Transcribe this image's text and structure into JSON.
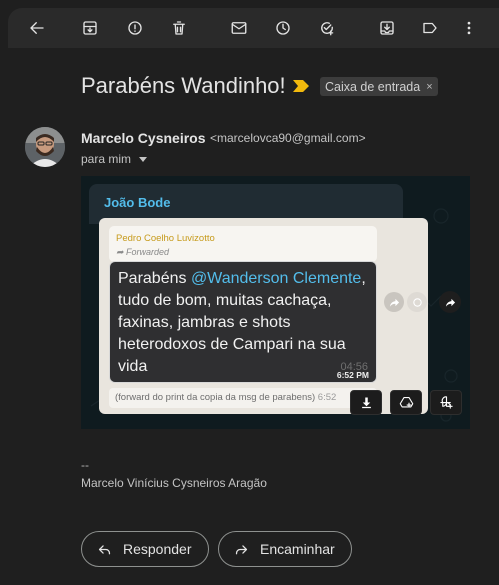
{
  "toolbar": {
    "icons": [
      "back-arrow-icon",
      "archive-icon",
      "report-spam-icon",
      "delete-icon",
      "mark-unread-icon",
      "snooze-icon",
      "add-to-tasks-icon",
      "move-to-icon",
      "label-icon",
      "more-vert-icon"
    ]
  },
  "email": {
    "subject": "Parabéns Wandinho!",
    "label": "Caixa de entrada",
    "label_remove": "×",
    "sender_name": "Marcelo Cysneiros",
    "sender_email": "<marcelovca90@gmail.com>",
    "to_text": "para mim"
  },
  "attachment": {
    "chat_name": "João Bode",
    "quote_author": "Pedro Coelho Luvizotto",
    "quote_forwarded": "Forwarded",
    "message_prefix": "Parabéns ",
    "message_mention": "@Wanderson Clemente",
    "message_rest": ", tudo de bom, muitas cachaça, faxinas, jambras e shots heterodoxos de Campari na sua vida",
    "time_ghost": "04:56",
    "time": "6:52 PM",
    "caption": "(forward do print da copia da msg de parabens)",
    "caption_time": "6:52"
  },
  "signature": {
    "dash": "--",
    "name": "Marcelo Vinícius Cysneiros Aragão"
  },
  "actions": {
    "reply_label": "Responder",
    "forward_label": "Encaminhar"
  },
  "colors": {
    "background": "#1f1f1f",
    "toolbar": "#2a2a2a",
    "importance_marker": "#f2b90d",
    "mention": "#53bdeb",
    "chat_title": "#53bdeb",
    "quote_author": "#c79b1c"
  }
}
